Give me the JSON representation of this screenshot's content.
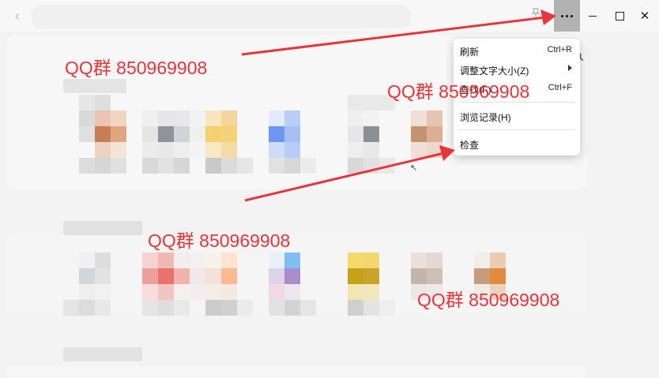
{
  "window": {
    "back_icon": "chevron-left-icon",
    "pin_icon": "pin-icon",
    "more_icon": "more-dots-icon",
    "min_icon": "minimize-icon",
    "max_icon": "maximize-icon",
    "close_icon": "close-icon",
    "close_glyph": "✕",
    "back_glyph": "‹"
  },
  "context_menu": {
    "items": [
      {
        "label": "刷新",
        "shortcut": "Ctrl+R"
      },
      {
        "label": "调整文字大小(Z)",
        "submenu": true
      },
      {
        "label": "查找(F)...",
        "shortcut": "Ctrl+F"
      },
      {
        "label": "浏览记录(H)"
      },
      {
        "label": "检查"
      }
    ]
  },
  "watermarks": [
    "QQ群 850969908",
    "QQ群 850969908",
    "QQ群 850969908",
    "QQ群 850969908"
  ],
  "colors": {
    "watermark": "#e8353a",
    "arrow": "#e8353a",
    "more_button_bg": "#b2b2b2"
  },
  "glyphs": {
    "search": "🔍",
    "cursor": "↖"
  }
}
